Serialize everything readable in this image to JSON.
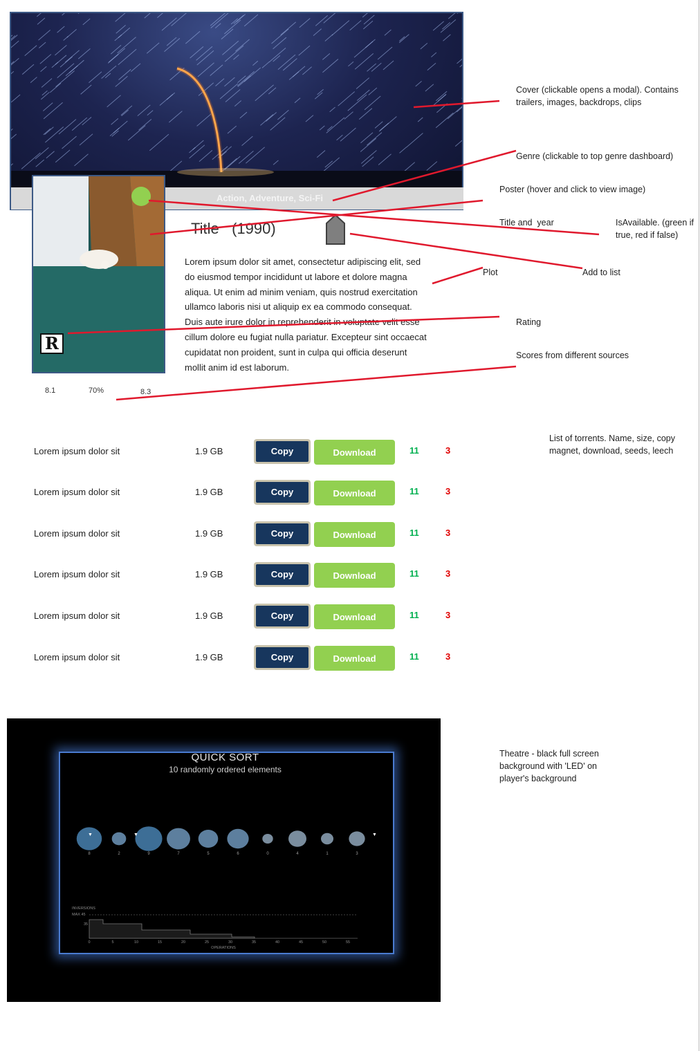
{
  "movie": {
    "genres": "Action, Adventure, Sci-Fi",
    "title": "Title",
    "year": "(1990)",
    "plot": "Lorem ipsum dolor sit amet, consectetur adipiscing elit, sed do eiusmod tempor incididunt ut labore et dolore magna aliqua. Ut enim ad minim veniam, quis nostrud exercitation ullamco laboris nisi ut aliquip ex ea commodo consequat. Duis aute irure dolor in reprehenderit in voluptate velit esse cillum dolore eu fugiat nulla pariatur. Excepteur sint occaecat cupidatat non proident, sunt in culpa qui officia deserunt mollit anim id est laborum.",
    "rating": "R",
    "is_available": true,
    "available_color": "#92d050",
    "scores": [
      "8.1",
      "70%",
      "8.3"
    ]
  },
  "annotations": {
    "cover": "Cover (clickable opens a modal). Contains trailers, images, backdrops, clips",
    "genre": "Genre (clickable to top genre dashboard)",
    "poster": "Poster (hover and click to view image)",
    "title_year": "Title and  year",
    "is_available": "IsAvailable. (green if true, red if false)",
    "plot": "Plot",
    "add_to_list": "Add to list",
    "rating": "Rating",
    "scores": "Scores from different sources",
    "torrents": "List of torrents. Name, size, copy magnet, download, seeds, leech",
    "theatre": "Theatre - black full screen background with 'LED' on player's background"
  },
  "torrents": [
    {
      "name": "Lorem ipsum dolor sit",
      "size": "1.9 GB",
      "copy": "Copy",
      "download": "Download",
      "seeds": "11",
      "leech": "3"
    },
    {
      "name": "Lorem ipsum dolor sit",
      "size": "1.9 GB",
      "copy": "Copy",
      "download": "Download",
      "seeds": "11",
      "leech": "3"
    },
    {
      "name": "Lorem ipsum dolor sit",
      "size": "1.9 GB",
      "copy": "Copy",
      "download": "Download",
      "seeds": "11",
      "leech": "3"
    },
    {
      "name": "Lorem ipsum dolor sit",
      "size": "1.9 GB",
      "copy": "Copy",
      "download": "Download",
      "seeds": "11",
      "leech": "3"
    },
    {
      "name": "Lorem ipsum dolor sit",
      "size": "1.9 GB",
      "copy": "Copy",
      "download": "Download",
      "seeds": "11",
      "leech": "3"
    },
    {
      "name": "Lorem ipsum dolor sit",
      "size": "1.9 GB",
      "copy": "Copy",
      "download": "Download",
      "seeds": "11",
      "leech": "3"
    }
  ],
  "theatre": {
    "title": "QUICK SORT",
    "subtitle": "10 randomly ordered elements",
    "elements": [
      "8",
      "2",
      "9",
      "7",
      "5",
      "6",
      "0",
      "4",
      "1",
      "3"
    ],
    "inversions_label": "INVERSIONS",
    "max_label": "MAX 45",
    "y_tick": "35",
    "x_ticks": [
      "0",
      "5",
      "10",
      "15",
      "20",
      "25",
      "30",
      "35",
      "40",
      "45",
      "50",
      "55"
    ],
    "x_label": "OPERATIONS"
  },
  "colors": {
    "copy_button": "#17365d",
    "download_button": "#92d050",
    "seeds": "#00b050",
    "leech": "#e00000",
    "annotation_line": "#e0192d",
    "led_glow": "#4a7bd0"
  }
}
